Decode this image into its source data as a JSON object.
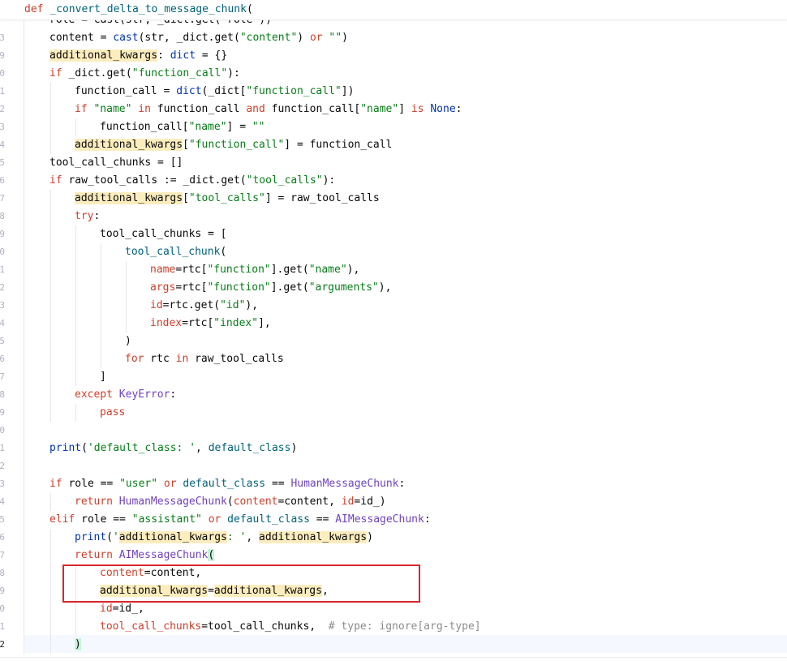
{
  "sticky_header": {
    "def_kw": "def",
    "func_name": "_convert_delta_to_message_chunk",
    "open_paren": "("
  },
  "line_numbers": [
    "3",
    "9",
    "0",
    "1",
    "2",
    "3",
    "4",
    "5",
    "6",
    "7",
    "8",
    "9",
    "0",
    "1",
    "2",
    "3",
    "4",
    "5",
    "6",
    "7",
    "8",
    "9",
    "0",
    "1",
    "2",
    "3",
    "4",
    "5",
    "6",
    "7",
    "8",
    "9",
    "0",
    "1",
    "2"
  ],
  "lines": [
    {
      "id": "l0",
      "indent": 1,
      "tokens": [
        [
          "plain",
          "role = cast(str, _dict.get(\"role\"))"
        ]
      ]
    },
    {
      "id": "l1",
      "indent": 1,
      "tokens": [
        [
          "plain",
          "content = "
        ],
        [
          "builtin",
          "cast"
        ],
        [
          "plain",
          "(str, _dict.get("
        ],
        [
          "str",
          "\"content\""
        ],
        [
          "plain",
          ") "
        ],
        [
          "kw2",
          "or"
        ],
        [
          "plain",
          " "
        ],
        [
          "str",
          "\"\""
        ],
        [
          "plain",
          ")"
        ]
      ]
    },
    {
      "id": "l2",
      "indent": 1,
      "tokens": [
        [
          "hl",
          "additional_kwargs"
        ],
        [
          "plain",
          ": "
        ],
        [
          "kw",
          "dict"
        ],
        [
          "plain",
          " = {}"
        ]
      ]
    },
    {
      "id": "l3",
      "indent": 1,
      "tokens": [
        [
          "kw2",
          "if"
        ],
        [
          "plain",
          " _dict.get("
        ],
        [
          "str",
          "\"function_call\""
        ],
        [
          "plain",
          "):"
        ]
      ]
    },
    {
      "id": "l4",
      "indent": 2,
      "tokens": [
        [
          "plain",
          "function_call = "
        ],
        [
          "kw",
          "dict"
        ],
        [
          "plain",
          "(_dict["
        ],
        [
          "str",
          "\"function_call\""
        ],
        [
          "plain",
          "])"
        ]
      ]
    },
    {
      "id": "l5",
      "indent": 2,
      "tokens": [
        [
          "kw2",
          "if"
        ],
        [
          "plain",
          " "
        ],
        [
          "str",
          "\"name\""
        ],
        [
          "plain",
          " "
        ],
        [
          "kw2",
          "in"
        ],
        [
          "plain",
          " function_call "
        ],
        [
          "kw2",
          "and"
        ],
        [
          "plain",
          " function_call["
        ],
        [
          "str",
          "\"name\""
        ],
        [
          "plain",
          "] "
        ],
        [
          "kw2",
          "is"
        ],
        [
          "plain",
          " "
        ],
        [
          "kw",
          "None"
        ],
        [
          "plain",
          ":"
        ]
      ]
    },
    {
      "id": "l6",
      "indent": 3,
      "tokens": [
        [
          "plain",
          "function_call["
        ],
        [
          "str",
          "\"name\""
        ],
        [
          "plain",
          "] = "
        ],
        [
          "str",
          "\"\""
        ]
      ]
    },
    {
      "id": "l7",
      "indent": 2,
      "tokens": [
        [
          "hl",
          "additional_kwargs"
        ],
        [
          "plain",
          "["
        ],
        [
          "str",
          "\"function_call\""
        ],
        [
          "plain",
          "] = function_call"
        ]
      ]
    },
    {
      "id": "l8",
      "indent": 1,
      "tokens": [
        [
          "plain",
          "tool_call_chunks = []"
        ]
      ]
    },
    {
      "id": "l9",
      "indent": 1,
      "tokens": [
        [
          "kw2",
          "if"
        ],
        [
          "plain",
          " raw_tool_calls := _dict.get("
        ],
        [
          "str",
          "\"tool_calls\""
        ],
        [
          "plain",
          "):"
        ]
      ]
    },
    {
      "id": "l10",
      "indent": 2,
      "tokens": [
        [
          "hl",
          "additional_kwargs"
        ],
        [
          "plain",
          "["
        ],
        [
          "str",
          "\"tool_calls\""
        ],
        [
          "plain",
          "] = raw_tool_calls"
        ]
      ]
    },
    {
      "id": "l11",
      "indent": 2,
      "tokens": [
        [
          "kw2",
          "try"
        ],
        [
          "plain",
          ":"
        ]
      ]
    },
    {
      "id": "l12",
      "indent": 3,
      "tokens": [
        [
          "plain",
          "tool_call_chunks = ["
        ]
      ]
    },
    {
      "id": "l13",
      "indent": 4,
      "tokens": [
        [
          "fn",
          "tool_call_chunk"
        ],
        [
          "plain",
          "("
        ]
      ]
    },
    {
      "id": "l14",
      "indent": 5,
      "tokens": [
        [
          "param",
          "name"
        ],
        [
          "plain",
          "=rtc["
        ],
        [
          "str",
          "\"function\""
        ],
        [
          "plain",
          "].get("
        ],
        [
          "str",
          "\"name\""
        ],
        [
          "plain",
          "),"
        ]
      ]
    },
    {
      "id": "l15",
      "indent": 5,
      "tokens": [
        [
          "param",
          "args"
        ],
        [
          "plain",
          "=rtc["
        ],
        [
          "str",
          "\"function\""
        ],
        [
          "plain",
          "].get("
        ],
        [
          "str",
          "\"arguments\""
        ],
        [
          "plain",
          "),"
        ]
      ]
    },
    {
      "id": "l16",
      "indent": 5,
      "tokens": [
        [
          "param",
          "id"
        ],
        [
          "plain",
          "=rtc.get("
        ],
        [
          "str",
          "\"id\""
        ],
        [
          "plain",
          "),"
        ]
      ]
    },
    {
      "id": "l17",
      "indent": 5,
      "tokens": [
        [
          "param",
          "index"
        ],
        [
          "plain",
          "=rtc["
        ],
        [
          "str",
          "\"index\""
        ],
        [
          "plain",
          "],"
        ]
      ]
    },
    {
      "id": "l18",
      "indent": 4,
      "tokens": [
        [
          "plain",
          ")"
        ]
      ]
    },
    {
      "id": "l19",
      "indent": 4,
      "tokens": [
        [
          "kw2",
          "for"
        ],
        [
          "plain",
          " rtc "
        ],
        [
          "kw2",
          "in"
        ],
        [
          "plain",
          " raw_tool_calls"
        ]
      ]
    },
    {
      "id": "l20",
      "indent": 3,
      "tokens": [
        [
          "plain",
          "]"
        ]
      ]
    },
    {
      "id": "l21",
      "indent": 2,
      "tokens": [
        [
          "kw2",
          "except"
        ],
        [
          "plain",
          " "
        ],
        [
          "cls",
          "KeyError"
        ],
        [
          "plain",
          ":"
        ]
      ]
    },
    {
      "id": "l22",
      "indent": 3,
      "tokens": [
        [
          "kw2",
          "pass"
        ]
      ]
    },
    {
      "id": "l23",
      "indent": 1,
      "tokens": []
    },
    {
      "id": "l24",
      "indent": 1,
      "tokens": [
        [
          "builtin",
          "print"
        ],
        [
          "plain",
          "("
        ],
        [
          "str",
          "'default_class: '"
        ],
        [
          "plain",
          ", "
        ],
        [
          "fn",
          "default_class"
        ],
        [
          "plain",
          ")"
        ]
      ]
    },
    {
      "id": "l25",
      "indent": 1,
      "tokens": []
    },
    {
      "id": "l26",
      "indent": 1,
      "tokens": [
        [
          "kw2",
          "if"
        ],
        [
          "plain",
          " role == "
        ],
        [
          "str",
          "\"user\""
        ],
        [
          "plain",
          " "
        ],
        [
          "kw2",
          "or"
        ],
        [
          "plain",
          " "
        ],
        [
          "fn",
          "default_class"
        ],
        [
          "plain",
          " == "
        ],
        [
          "cls",
          "HumanMessageChunk"
        ],
        [
          "plain",
          ":"
        ]
      ]
    },
    {
      "id": "l27",
      "indent": 2,
      "tokens": [
        [
          "kw2",
          "return"
        ],
        [
          "plain",
          " "
        ],
        [
          "cls",
          "HumanMessageChunk"
        ],
        [
          "plain",
          "("
        ],
        [
          "param",
          "content"
        ],
        [
          "plain",
          "=content, "
        ],
        [
          "param",
          "id"
        ],
        [
          "plain",
          "=id_)"
        ]
      ]
    },
    {
      "id": "l28",
      "indent": 1,
      "tokens": [
        [
          "kw2",
          "elif"
        ],
        [
          "plain",
          " role == "
        ],
        [
          "str",
          "\"assistant\""
        ],
        [
          "plain",
          " "
        ],
        [
          "kw2",
          "or"
        ],
        [
          "plain",
          " "
        ],
        [
          "fn",
          "default_class"
        ],
        [
          "plain",
          " == "
        ],
        [
          "cls",
          "AIMessageChunk"
        ],
        [
          "plain",
          ":"
        ]
      ]
    },
    {
      "id": "l29",
      "indent": 2,
      "tokens": [
        [
          "builtin",
          "print"
        ],
        [
          "plain",
          "("
        ],
        [
          "str",
          "'"
        ],
        [
          "hl",
          "additional_kwargs"
        ],
        [
          "str",
          ": '"
        ],
        [
          "plain",
          ", "
        ],
        [
          "hl",
          "additional_kwargs"
        ],
        [
          "plain",
          ")"
        ]
      ]
    },
    {
      "id": "l30",
      "indent": 2,
      "tokens": [
        [
          "kw2",
          "return"
        ],
        [
          "plain",
          " "
        ],
        [
          "cls",
          "AIMessageChunk"
        ],
        [
          "bracket",
          "("
        ]
      ]
    },
    {
      "id": "l31",
      "indent": 3,
      "tokens": [
        [
          "param",
          "content"
        ],
        [
          "plain",
          "=content,"
        ]
      ]
    },
    {
      "id": "l32",
      "indent": 3,
      "tokens": [
        [
          "hl",
          "additional_kwargs"
        ],
        [
          "plain",
          "="
        ],
        [
          "hl",
          "additional_kwargs"
        ],
        [
          "plain",
          ","
        ]
      ]
    },
    {
      "id": "l33",
      "indent": 3,
      "tokens": [
        [
          "param",
          "id"
        ],
        [
          "plain",
          "=id_,"
        ]
      ]
    },
    {
      "id": "l34",
      "indent": 3,
      "tokens": [
        [
          "param",
          "tool_call_chunks"
        ],
        [
          "plain",
          "=tool_call_chunks,  "
        ],
        [
          "cmt",
          "# type: ignore[arg-type]"
        ]
      ]
    },
    {
      "id": "l35",
      "indent": 2,
      "tokens": [
        [
          "bracket",
          ")"
        ]
      ]
    }
  ],
  "colors": {
    "keyword": "#cf3e2a",
    "string": "#067d17",
    "highlight": "#fcedbe",
    "callout_border": "#d9262e"
  }
}
